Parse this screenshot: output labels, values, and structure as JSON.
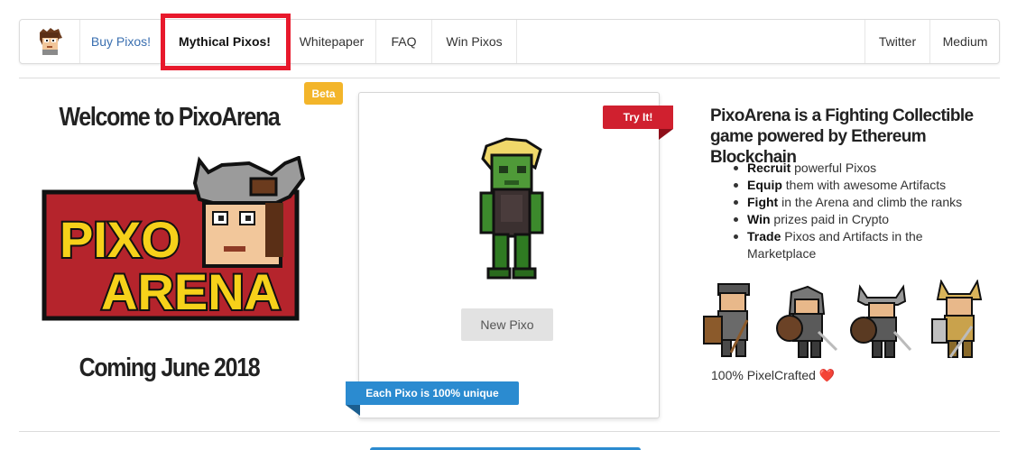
{
  "nav": {
    "buy": "Buy Pixos!",
    "mythical": "Mythical Pixos!",
    "whitepaper": "Whitepaper",
    "faq": "FAQ",
    "win": "Win Pixos",
    "twitter": "Twitter",
    "medium": "Medium"
  },
  "left": {
    "welcome": "Welcome to PixoArena",
    "coming": "Coming June 2018"
  },
  "logo_text": [
    "PIXO",
    "ARENA"
  ],
  "card": {
    "beta": "Beta",
    "try_it": "Try It!",
    "new_pixo": "New Pixo",
    "unique": "Each Pixo is 100% unique"
  },
  "right": {
    "headline": "PixoArena is a Fighting Collectible game powered by Ethereum Blockchain",
    "features": [
      {
        "bold": "Recruit",
        "text": " powerful Pixos"
      },
      {
        "bold": "Equip",
        "text": " them with awesome Artifacts"
      },
      {
        "bold": "Fight",
        "text": " in the Arena and climb the ranks"
      },
      {
        "bold": "Win",
        "text": " prizes paid in Crypto"
      },
      {
        "bold": "Trade",
        "text": " Pixos and Artifacts in the Marketplace"
      }
    ],
    "crafted": "100% PixelCrafted",
    "heart": "❤️"
  },
  "colors": {
    "accent_blue": "#2b8bd0",
    "try_red": "#d0202f",
    "beta_yellow": "#f3b52a",
    "highlight": "#e8192c"
  }
}
